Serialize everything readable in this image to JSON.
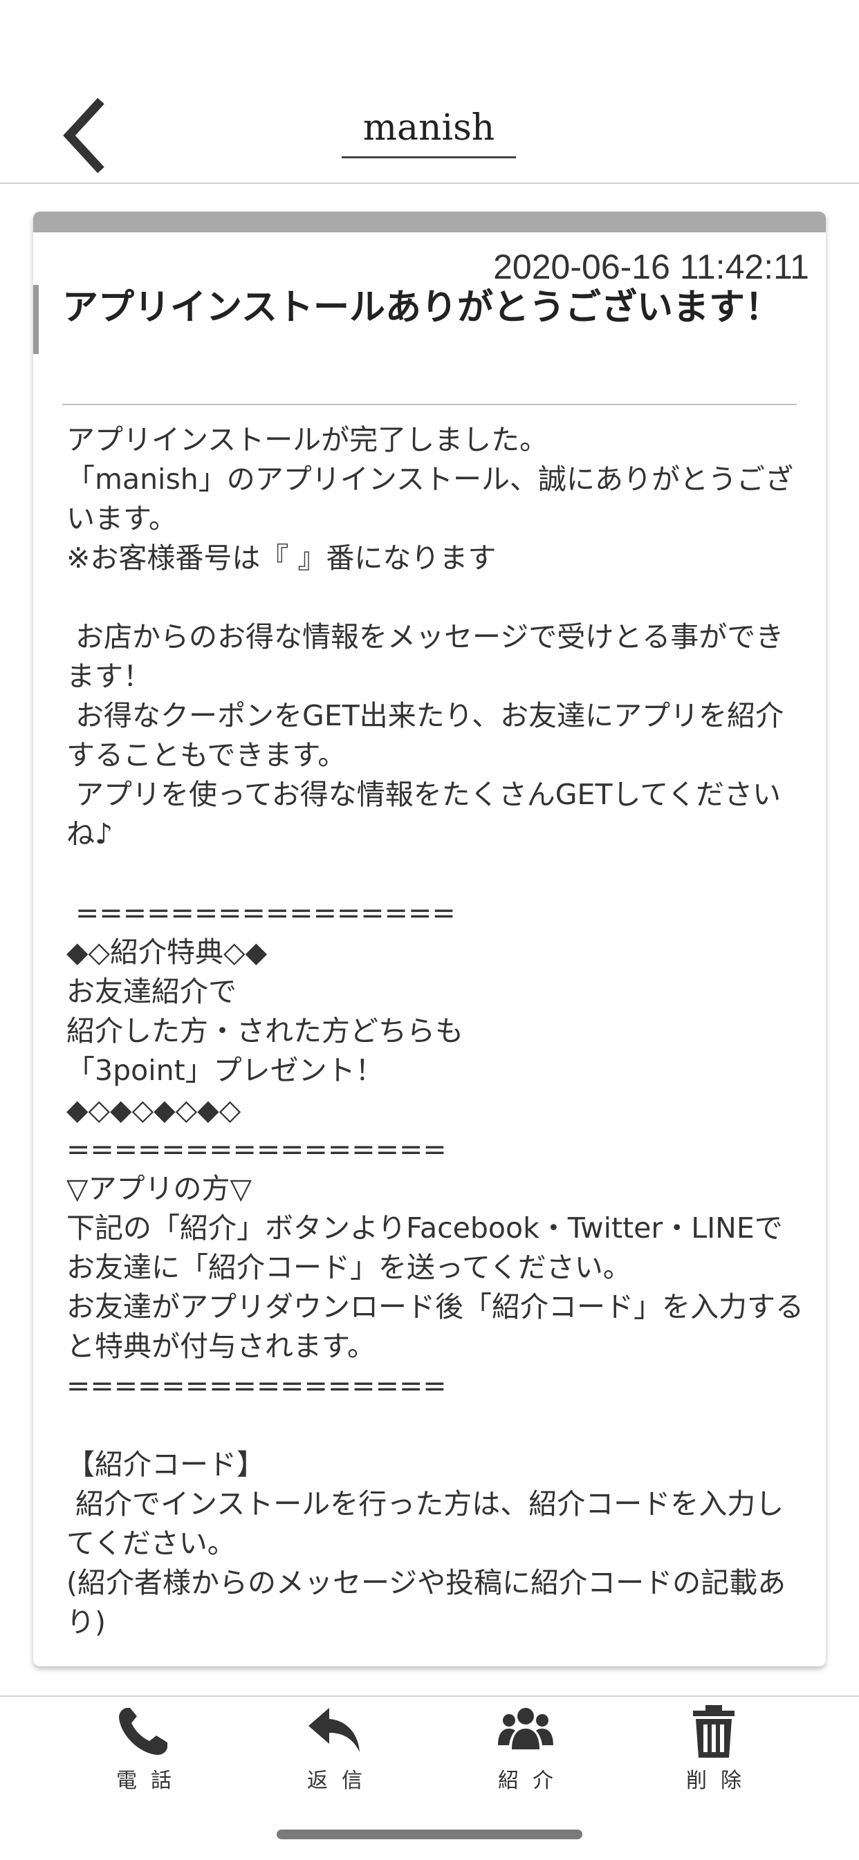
{
  "header": {
    "title": "manish",
    "back_icon": "chevron-left-icon"
  },
  "message": {
    "date": "2020-06-16 11:42:11",
    "title": "アプリインストールありがとうございます！",
    "body": "アプリインストールが完了しました。\n「manish」のアプリインストール、誠にありがとうございます。\n※お客様番号は『 』番になります\n\n お店からのお得な情報をメッセージで受けとる事ができます！\n お得なクーポンをGET出来たり、お友達にアプリを紹介することもできます。\n アプリを使ってお得な情報をたくさんGETしてくださいね♪\n\n ================\n◆◇紹介特典◇◆\nお友達紹介で\n紹介した方・された方どちらも\n「3point」プレゼント！\n◆◇◆◇◆◇◆◇\n================\n▽アプリの方▽\n下記の「紹介」ボタンよりFacebook・Twitter・LINEでお友達に「紹介コード」を送ってください。\nお友達がアプリダウンロード後「紹介コード」を入力すると特典が付与されます。\n================\n\n【紹介コード】\n 紹介でインストールを行った方は、紹介コードを入力してください。\n(紹介者様からのメッセージや投稿に紹介コードの記載あり)"
  },
  "bottom_nav": {
    "items": [
      {
        "label": "電話",
        "icon": "phone-icon"
      },
      {
        "label": "返信",
        "icon": "reply-icon"
      },
      {
        "label": "紹介",
        "icon": "users-icon"
      },
      {
        "label": "削除",
        "icon": "trash-icon"
      }
    ]
  },
  "colors": {
    "card_topbar": "#a9a9a9",
    "text": "#333333",
    "background": "#ffffff"
  }
}
